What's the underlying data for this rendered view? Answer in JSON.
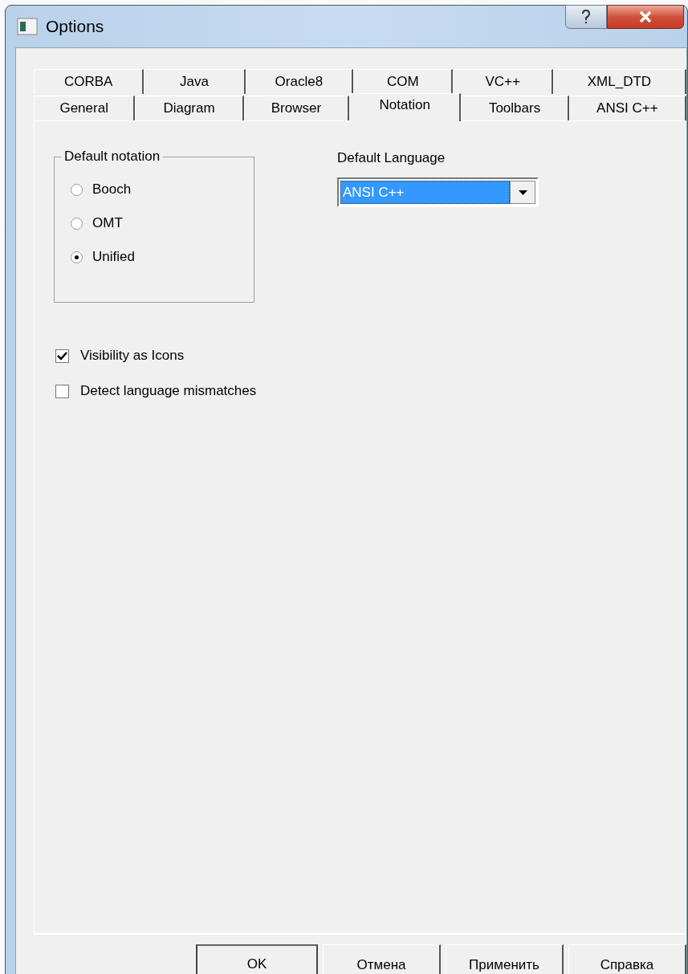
{
  "window": {
    "title": "Options"
  },
  "tab_rows": [
    {
      "tabs": [
        {
          "label": "CORBA",
          "selected": false
        },
        {
          "label": "Java",
          "selected": false
        },
        {
          "label": "Oracle8",
          "selected": false
        },
        {
          "label": "COM",
          "selected": false
        },
        {
          "label": "VC++",
          "selected": false
        },
        {
          "label": "XML_DTD",
          "selected": false
        }
      ]
    },
    {
      "tabs": [
        {
          "label": "General",
          "selected": false
        },
        {
          "label": "Diagram",
          "selected": false
        },
        {
          "label": "Browser",
          "selected": false
        },
        {
          "label": "Notation",
          "selected": true
        },
        {
          "label": "Toolbars",
          "selected": false
        },
        {
          "label": "ANSI C++",
          "selected": false
        }
      ]
    }
  ],
  "default_notation": {
    "title": "Default notation",
    "options": [
      {
        "label": "Booch",
        "selected": false
      },
      {
        "label": "OMT",
        "selected": false
      },
      {
        "label": "Unified",
        "selected": true
      }
    ]
  },
  "default_language": {
    "label": "Default Language",
    "value": "ANSI C++"
  },
  "checkboxes": [
    {
      "label": "Visibility as Icons",
      "checked": true
    },
    {
      "label": "Detect language mismatches",
      "checked": false
    }
  ],
  "buttons": [
    {
      "label": "OK",
      "default": true
    },
    {
      "label": "Отмена",
      "default": false
    },
    {
      "label": "Применить",
      "default": false
    },
    {
      "label": "Справка",
      "default": false
    }
  ]
}
